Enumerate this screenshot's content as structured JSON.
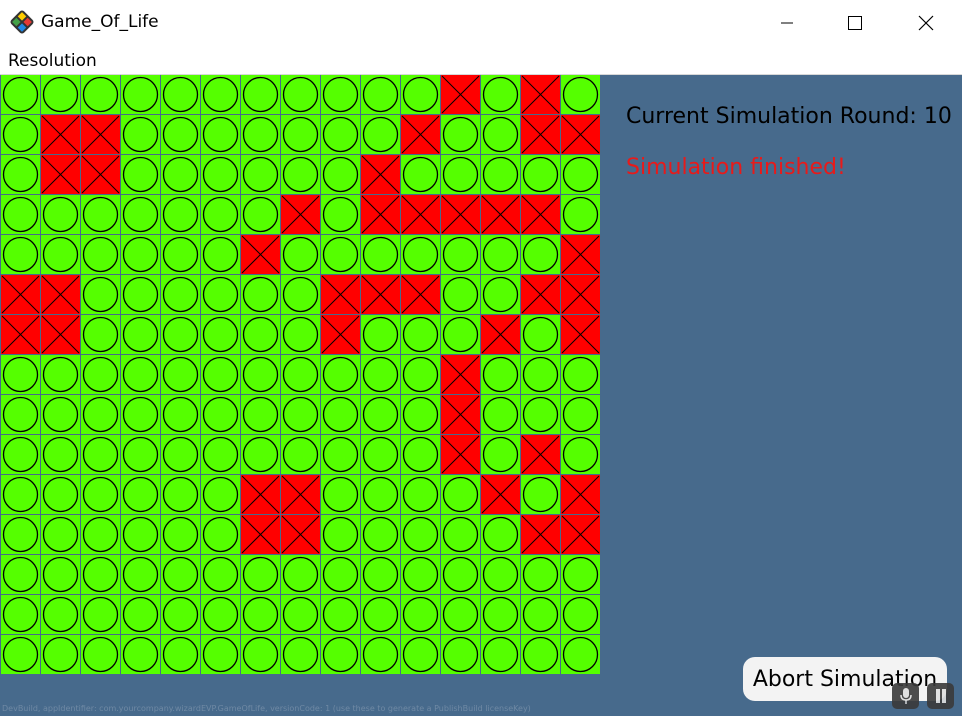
{
  "window": {
    "title": "Game_Of_Life",
    "app_icon": "game-controller-icon",
    "controls": [
      "minimize-icon",
      "maximize-icon",
      "close-icon"
    ]
  },
  "menu": {
    "items": [
      "Resolution"
    ]
  },
  "board": {
    "rows": 15,
    "cols": 15,
    "cells": [
      "...........X.X.",
      ".XX.......X..XX",
      ".XX......X.....",
      ".......X.XXXXX.",
      "......X.......X",
      "XX......XXX..XX",
      "XX......X...X.X",
      "...........X...",
      "...........X...",
      "...........X.X.",
      "......XX....X.X",
      "......XX.....XX",
      "...............",
      "...............",
      "..............."
    ],
    "legend": {
      "alive_symbol": "circle",
      "dead_symbol": "cross"
    },
    "colors": {
      "alive": "#55ff00",
      "dead": "#ff0000",
      "grid_line": "#476a8c"
    }
  },
  "status": {
    "round_text": "Current Simulation Round: 10",
    "message": "Simulation finished!",
    "message_color": "#e81a1a"
  },
  "actions": {
    "abort_label": "Abort Simulation"
  },
  "footer": {
    "text": "DevBuild, appIdentifier: com.yourcompany.wizardEVP.GameOfLife, versionCode: 1 (use these to generate a PublishBuild licenseKey)"
  },
  "overlay_controls": [
    "microphone-icon",
    "pause-icon"
  ]
}
